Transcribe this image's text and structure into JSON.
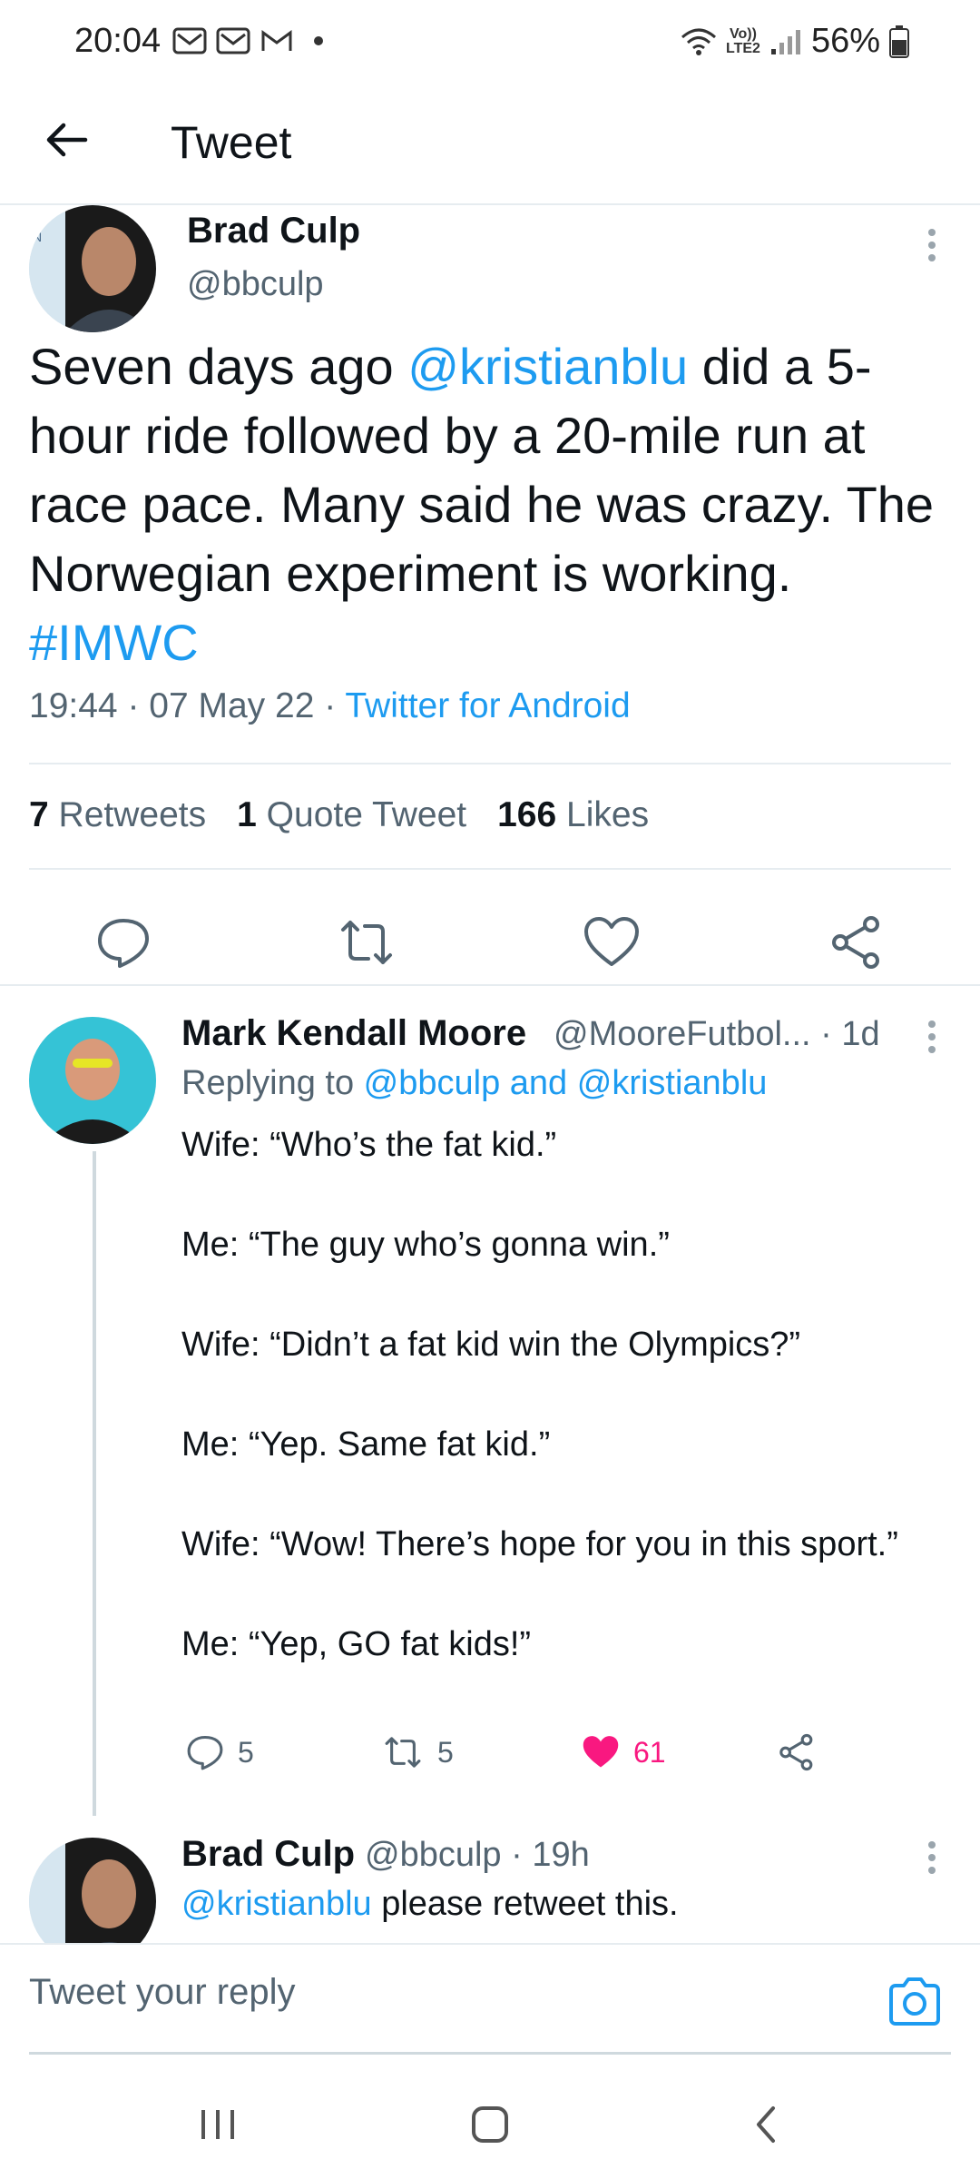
{
  "status_bar": {
    "time": "20:04",
    "net_top": "Vo))",
    "net_bottom": "LTE2",
    "battery": "56%"
  },
  "header": {
    "title": "Tweet"
  },
  "main_tweet": {
    "author_name": "Brad Culp",
    "author_handle": "@bbculp",
    "text_pre": "Seven days ago ",
    "mention": "@kristianblu",
    "text_post": " did a 5-hour ride followed by a 20-mile run at race pace. Many said he was crazy. The Norwegian experiment is working. ",
    "hashtag": "#IMWC",
    "time": "19:44",
    "date": "07 May 22",
    "source": "Twitter for Android",
    "retweets_count": "7",
    "retweets_label": "Retweets",
    "quotes_count": "1",
    "quotes_label": "Quote Tweet",
    "likes_count": "166",
    "likes_label": "Likes"
  },
  "reply": {
    "author_name": "Mark Kendall Moore",
    "author_handle": "@MooreFutbol...",
    "age": "· 1d",
    "replying_prefix": "Replying to ",
    "replying_targets": "@bbculp and @kristianblu",
    "lines": [
      "Wife:  “Who’s the fat kid.”",
      "Me:  “The guy who’s gonna win.”",
      "Wife:  “Didn’t a fat kid win the Olympics?”",
      "Me:  “Yep.  Same fat kid.”",
      "Wife:  “Wow!  There’s hope for you in this sport.”",
      "Me:  “Yep, GO fat kids!”"
    ],
    "replies_count": "5",
    "retweets_count": "5",
    "likes_count": "61"
  },
  "second_reply": {
    "author_name": "Brad Culp",
    "author_handle": "@bbculp",
    "age": "· 19h",
    "mention": "@kristianblu",
    "text": " please retweet this."
  },
  "composer": {
    "placeholder": "Tweet your reply"
  },
  "colors": {
    "accent": "#1d9bf0",
    "like_active": "#f91880",
    "secondary_text": "#536471"
  }
}
